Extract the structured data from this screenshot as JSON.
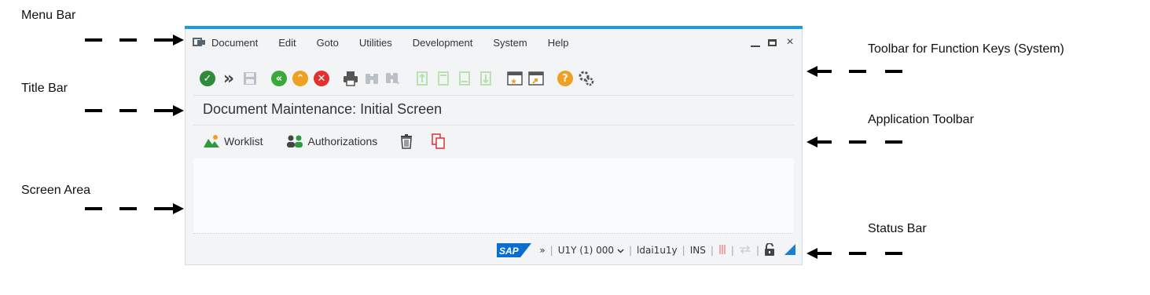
{
  "annotations": {
    "menu_bar": "Menu Bar",
    "title_bar": "Title Bar",
    "screen_area": "Screen Area",
    "toolbar_function_keys": "Toolbar for Function Keys (System)",
    "application_toolbar": "Application Toolbar",
    "status_bar": "Status Bar"
  },
  "menu": {
    "items": [
      "Document",
      "Edit",
      "Goto",
      "Utilities",
      "Development",
      "System",
      "Help"
    ]
  },
  "window_controls": {
    "close": "×"
  },
  "toolbar": {
    "icons": [
      "enter-icon",
      "expand-icon",
      "save-icon",
      "back-icon",
      "exit-icon",
      "cancel-icon",
      "print-icon",
      "find-icon",
      "find-next-icon",
      "first-page-icon",
      "previous-page-icon",
      "next-page-icon",
      "last-page-icon",
      "create-session-icon",
      "shortcut-icon",
      "help-icon",
      "customize-icon"
    ],
    "colors": {
      "enter": "#2e8b3a",
      "back": "#3aa83a",
      "exit": "#f0a020",
      "cancel": "#e03030",
      "help": "#f0a020"
    }
  },
  "title": "Document Maintenance: Initial Screen",
  "app_toolbar": {
    "worklist": "Worklist",
    "authorizations": "Authorizations"
  },
  "status_bar": {
    "more": "»",
    "system": "U1Y (1) 000",
    "user": "ldai1u1y",
    "mode": "INS",
    "sap_logo": "SAP"
  },
  "colors": {
    "accent": "#1b9ae0",
    "sap_logo_blue": "#0a6ed1"
  }
}
